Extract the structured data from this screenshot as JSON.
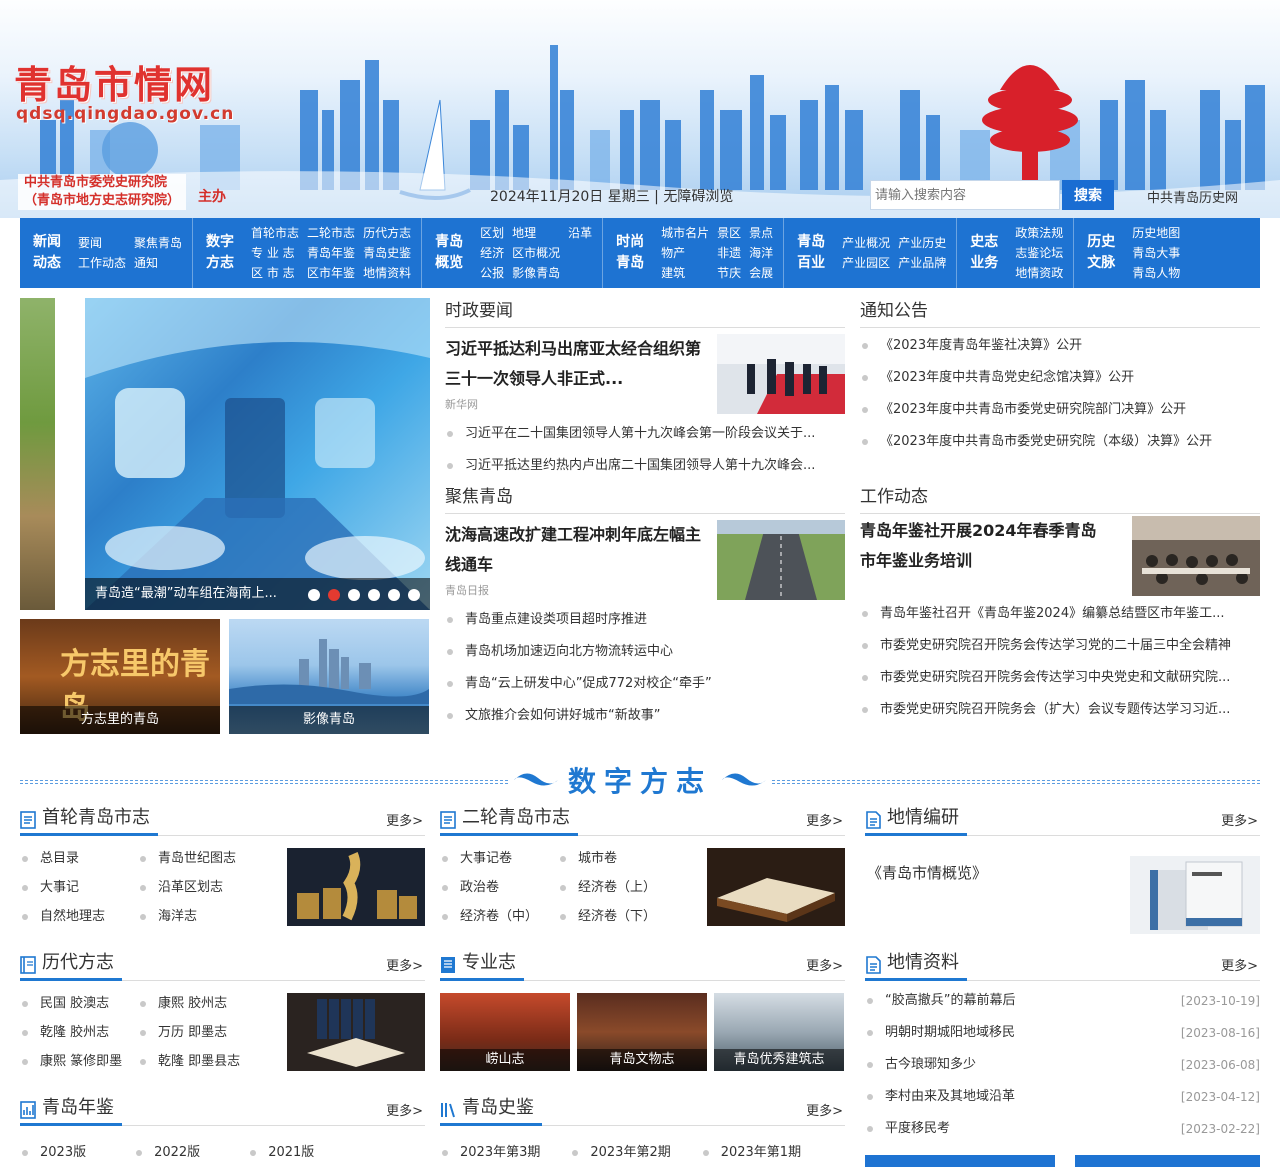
{
  "header": {
    "site_title": "青岛市情网",
    "site_url": "qdsq.qingdao.gov.cn",
    "sponsor_line1": "中共青岛市委党史研究院",
    "sponsor_line2": "（青岛市地方史志研究院）",
    "sponsor_host": "主办",
    "date": "2024年11月20日 星期三",
    "separator": " | ",
    "accessibility": "无障碍浏览",
    "search_placeholder": "请输入搜索内容",
    "search_button": "搜索",
    "history_link": "中共青岛历史网"
  },
  "nav": [
    {
      "head": "新闻动态",
      "cols": 2,
      "items": [
        "要闻",
        "聚焦青岛",
        "工作动态",
        "通知"
      ]
    },
    {
      "head": "数字方志",
      "cols": 3,
      "items": [
        "首轮市志",
        "二轮市志",
        "历代方志",
        "专 业 志",
        "青岛年鉴",
        "青岛史鉴",
        "区 市 志",
        "区市年鉴",
        "地情资料"
      ]
    },
    {
      "head": "青岛概览",
      "cols": 3,
      "items": [
        "区划",
        "地理",
        "沿革",
        "经济",
        "区市概况",
        "",
        "公报",
        "影像青岛",
        ""
      ]
    },
    {
      "head": "时尚青岛",
      "cols": 3,
      "items": [
        "城市名片",
        "景区",
        "景点",
        "物产",
        "非遗",
        "海洋",
        "建筑",
        "节庆",
        "会展"
      ]
    },
    {
      "head": "青岛百业",
      "cols": 2,
      "items": [
        "产业概况",
        "产业历史",
        "产业园区",
        "产业品牌"
      ]
    },
    {
      "head": "史志业务",
      "cols": 1,
      "items": [
        "政策法规",
        "志鉴论坛",
        "地情资政"
      ]
    },
    {
      "head": "历史文脉",
      "cols": 1,
      "items": [
        "历史地图",
        "青岛大事",
        "青岛人物"
      ]
    }
  ],
  "slider": {
    "caption": "青岛造“最潮”动车组在海南上...",
    "dot_count": 6,
    "active_dot": 2
  },
  "thumbs": [
    {
      "caption": "方志里的青岛",
      "overlay": "方志里的青岛"
    },
    {
      "caption": "影像青岛"
    }
  ],
  "politics": {
    "title": "时政要闻",
    "headline": "习近平抵达利马出席亚太经合组织第三十一次领导人非正式...",
    "source": "新华网",
    "items": [
      "习近平在二十国集团领导人第十九次峰会第一阶段会议关于...",
      "习近平抵达里约热内卢出席二十国集团领导人第十九次峰会..."
    ]
  },
  "notices": {
    "title": "通知公告",
    "items": [
      "《2023年度青岛年鉴社决算》公开",
      "《2023年度中共青岛党史纪念馆决算》公开",
      "《2023年度中共青岛市委党史研究院部门决算》公开",
      "《2023年度中共青岛市委党史研究院（本级）决算》公开"
    ]
  },
  "focus": {
    "title": "聚焦青岛",
    "headline": "沈海高速改扩建工程冲刺年底左幅主线通车",
    "source": "青岛日报",
    "items": [
      "青岛重点建设类项目超时序推进",
      "青岛机场加速迈向北方物流转运中心",
      "青岛“云上研发中心”促成772对校企“牵手”",
      "文旅推介会如何讲好城市“新故事”"
    ]
  },
  "work": {
    "title": "工作动态",
    "headline": "青岛年鉴社开展2024年春季青岛市年鉴业务培训",
    "items": [
      "青岛年鉴社召开《青岛年鉴2024》编纂总结暨区市年鉴工...",
      "市委党史研究院召开院务会传达学习党的二十届三中全会精神",
      "市委党史研究院召开院务会传达学习中央党史和文献研究院...",
      "市委党史研究院召开院务会（扩大）会议专题传达学习习近..."
    ]
  },
  "digital_title": "数字方志",
  "boxes": {
    "first_round": {
      "name": "首轮青岛市志",
      "more": "更多>",
      "links": [
        "总目录",
        "青岛世纪图志",
        "大事记",
        "沿革区划志",
        "自然地理志",
        "海洋志"
      ]
    },
    "second_round": {
      "name": "二轮青岛市志",
      "more": "更多>",
      "links": [
        "大事记卷",
        "城市卷",
        "政治卷",
        "经济卷（上）",
        "经济卷（中）",
        "经济卷（下）"
      ]
    },
    "survey": {
      "name": "地情编研",
      "more": "更多>",
      "link": "《青岛市情概览》"
    },
    "historic": {
      "name": "历代方志",
      "more": "更多>",
      "links": [
        "民国 胶澳志",
        "康熙 胶州志",
        "乾隆 胶州志",
        "万历 即墨志",
        "康熙 篆修即墨",
        "乾隆 即墨县志"
      ]
    },
    "professional": {
      "name": "专业志",
      "more": "更多>",
      "cards": [
        "崂山志",
        "青岛文物志",
        "青岛优秀建筑志"
      ]
    },
    "materials": {
      "name": "地情资料",
      "more": "更多>",
      "items": [
        {
          "title": "“胶高撤兵”的幕前幕后",
          "date": "[2023-10-19]"
        },
        {
          "title": "明朝时期城阳地域移民",
          "date": "[2023-08-16]"
        },
        {
          "title": "古今琅琊知多少",
          "date": "[2023-06-08]"
        },
        {
          "title": "李村由来及其地域沿革",
          "date": "[2023-04-12]"
        },
        {
          "title": "平度移民考",
          "date": "[2023-02-22]"
        }
      ]
    },
    "yearbook": {
      "name": "青岛年鉴",
      "more": "更多>",
      "links": [
        "2023版",
        "2022版",
        "2021版"
      ]
    },
    "history_mirror": {
      "name": "青岛史鉴",
      "more": "更多>",
      "links": [
        "2023年第3期",
        "2023年第2期",
        "2023年第1期"
      ]
    }
  },
  "colors": {
    "brand_blue": "#1e73d2",
    "brand_red": "#e0322f",
    "active_dot": "#e33a30"
  }
}
